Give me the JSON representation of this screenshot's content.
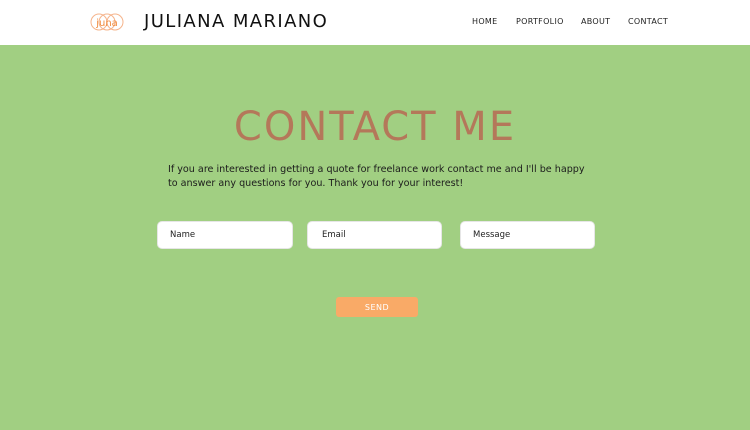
{
  "header": {
    "logo_text": "juna",
    "brand_name": "JULIANA MARIANO",
    "nav": [
      "HOME",
      "PORTFOLIO",
      "ABOUT",
      "CONTACT"
    ]
  },
  "main": {
    "title": "CONTACT ME",
    "intro": "If you are interested in getting a quote for freelance work contact me and I'll be happy to answer any questions for you. Thank you for your interest!"
  },
  "form": {
    "name_placeholder": "Name",
    "email_placeholder": "Email",
    "message_placeholder": "Message",
    "send_label": "SEND"
  },
  "colors": {
    "background": "#a1cf82",
    "header": "#ffffff",
    "title": "#b4785a",
    "accent": "#f9aa67"
  },
  "icons": {
    "logo": "juna-logo-icon"
  }
}
